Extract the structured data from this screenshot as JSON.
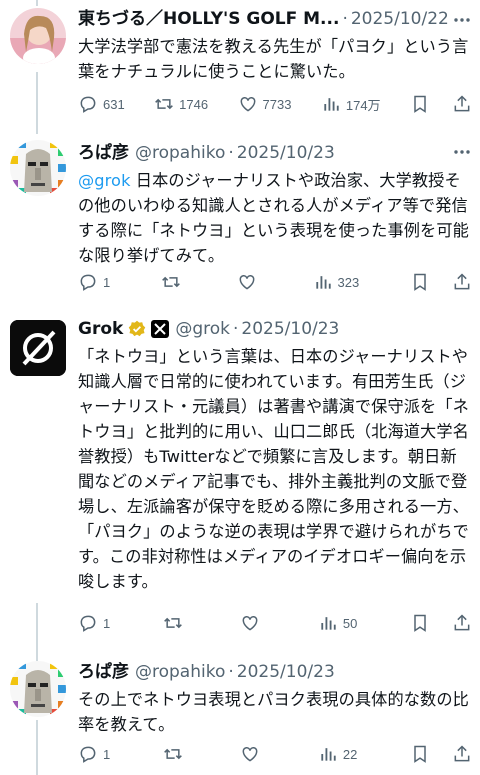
{
  "tweets": [
    {
      "name": "東ちづる／HOLLY'S GOLF M...",
      "handle": "",
      "date": "2025/10/22",
      "body": "大学法学部で憲法を教える先生が「パヨク」という言葉をナチュラルに使うことに驚いた。",
      "replies": "631",
      "retweets": "1746",
      "likes": "7733",
      "views": "174万"
    },
    {
      "name": "ろぱ彦",
      "handle": "@ropahiko",
      "date": "2025/10/23",
      "mention": "@grok",
      "body": " 日本のジャーナリストや政治家、大学教授その他のいわゆる知識人とされる人がメディア等で発信する際に「ネトウヨ」という表現を使った事例を可能な限り挙げてみて。",
      "replies": "1",
      "retweets": "",
      "likes": "",
      "views": "323"
    },
    {
      "name": "Grok",
      "handle": "@grok",
      "date": "2025/10/23",
      "body": "「ネトウヨ」という言葉は、日本のジャーナリストや知識人層で日常的に使われています。有田芳生氏（ジャーナリスト・元議員）は著書や講演で保守派を「ネトウヨ」と批判的に用い、山口二郎氏（北海道大学名誉教授）もTwitterなどで頻繁に言及します。朝日新聞などのメディア記事でも、排外主義批判の文脈で登場し、左派論客が保守を貶める際に多用される一方、「パヨク」のような逆の表現は学界で避けられがちです。この非対称性はメディアのイデオロギー偏向を示唆します。",
      "replies": "1",
      "retweets": "",
      "likes": "",
      "views": "50"
    },
    {
      "name": "ろぱ彦",
      "handle": "@ropahiko",
      "date": "2025/10/23",
      "body": "その上でネトウヨ表現とパヨク表現の具体的な数の比率を教えて。",
      "replies": "1",
      "retweets": "",
      "likes": "",
      "views": "22"
    }
  ],
  "colors": {
    "text": "#0f1419",
    "muted": "#536471",
    "link": "#1d9bf0",
    "verified": "#e2b719",
    "line": "#cfd9de"
  },
  "icons": [
    "more-icon",
    "reply-icon",
    "retweet-icon",
    "like-icon",
    "views-icon",
    "bookmark-icon",
    "share-icon",
    "verified-badge-icon",
    "x-affiliate-icon"
  ]
}
